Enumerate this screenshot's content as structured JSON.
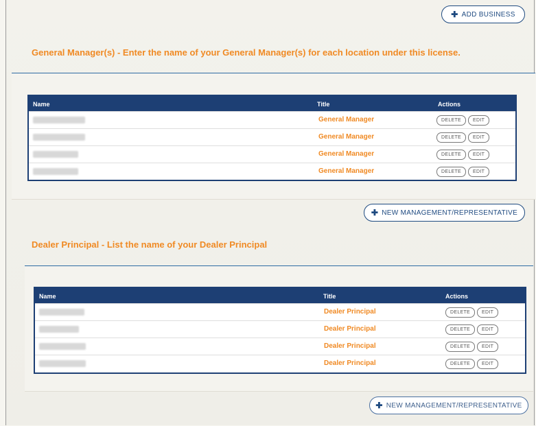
{
  "buttons": {
    "add_business": "ADD BUSINESS",
    "new_management_1": "NEW MANAGEMENT/REPRESENTATIVE",
    "new_management_2": "NEW MANAGEMENT/REPRESENTATIVE"
  },
  "gm_section": {
    "title": "General Manager(s) -  Enter the name of your General Manager(s) for each location under this license.",
    "headers": {
      "name": "Name",
      "title": "Title",
      "actions": "Actions"
    },
    "rows": [
      {
        "title": "General Manager",
        "delete": "DELETE",
        "edit": "EDIT"
      },
      {
        "title": "General Manager",
        "delete": "DELETE",
        "edit": "EDIT"
      },
      {
        "title": "General Manager",
        "delete": "DELETE",
        "edit": "EDIT"
      },
      {
        "title": "General Manager",
        "delete": "DELETE",
        "edit": "EDIT"
      }
    ]
  },
  "dp_section": {
    "title": "Dealer Principal - List the name of your Dealer Principal",
    "headers": {
      "name": "Name",
      "title": "Title",
      "actions": "Actions"
    },
    "rows": [
      {
        "title": "Dealer Principal",
        "delete": "DELETE",
        "edit": "EDIT"
      },
      {
        "title": "Dealer Principal",
        "delete": "DELETE",
        "edit": "EDIT"
      },
      {
        "title": "Dealer Principal",
        "delete": "DELETE",
        "edit": "EDIT"
      },
      {
        "title": "Dealer Principal",
        "delete": "DELETE",
        "edit": "EDIT"
      }
    ]
  },
  "icons": {
    "plus": "plus-icon"
  },
  "colors": {
    "accent": "#f08a24",
    "header": "#1d3f74"
  }
}
